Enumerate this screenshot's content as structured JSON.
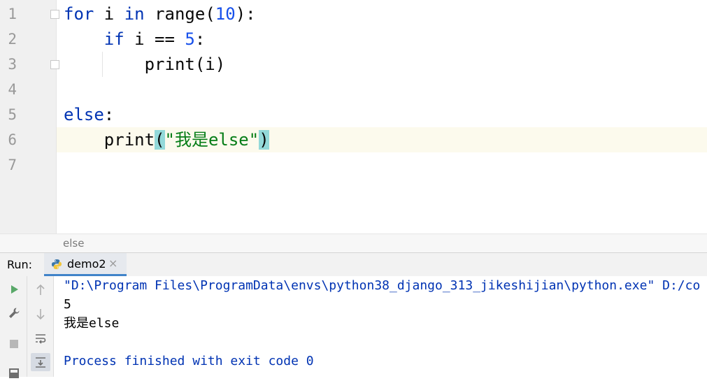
{
  "editor": {
    "line_numbers": [
      "1",
      "2",
      "3",
      "4",
      "5",
      "6",
      "7"
    ],
    "lines": [
      {
        "parts": [
          {
            "t": "for",
            "c": "kw"
          },
          {
            "t": " i "
          },
          {
            "t": "in",
            "c": "kw"
          },
          {
            "t": " range("
          },
          {
            "t": "10",
            "c": "num"
          },
          {
            "t": "):"
          }
        ]
      },
      {
        "parts": [
          {
            "t": "    "
          },
          {
            "t": "if",
            "c": "kw"
          },
          {
            "t": " i == "
          },
          {
            "t": "5",
            "c": "num"
          },
          {
            "t": ":"
          }
        ]
      },
      {
        "parts": [
          {
            "t": "        print(i)"
          }
        ]
      },
      {
        "parts": []
      },
      {
        "parts": [
          {
            "t": "else",
            "c": "kw"
          },
          {
            "t": ":"
          }
        ]
      },
      {
        "parts": [
          {
            "t": "    print"
          },
          {
            "t": "(",
            "c": "paren-hl"
          },
          {
            "t": "\"我是else\"",
            "c": "str"
          },
          {
            "t": ")",
            "c": "paren-hl"
          }
        ]
      },
      {
        "parts": []
      }
    ],
    "current_line": 6
  },
  "breadcrumb": {
    "text": "else"
  },
  "run": {
    "title": "Run:",
    "tab_label": "demo2",
    "tab_close": "×"
  },
  "console": {
    "lines": [
      {
        "text": "\"D:\\Program Files\\ProgramData\\envs\\python38_django_313_jikeshijian\\python.exe\" D:/co",
        "color": "#0033b3"
      },
      {
        "text": "5",
        "color": "#000000"
      },
      {
        "text": "我是else",
        "color": "#000000"
      },
      {
        "text": "",
        "color": "#000000"
      },
      {
        "text": "Process finished with exit code 0",
        "color": "#0033b3"
      }
    ]
  },
  "colors": {
    "keyword": "#0033b3",
    "number": "#1750eb",
    "string": "#067d17",
    "paren_highlight": "#93d9d9",
    "current_line": "#fcfaed",
    "run_green": "#59a869",
    "tab_underline": "#4083c9"
  },
  "icons": [
    "run-icon",
    "wrench-icon",
    "stop-icon",
    "layout-icon",
    "up-arrow-icon",
    "down-arrow-icon",
    "soft-wrap-icon",
    "scroll-to-end-icon",
    "python-icon",
    "fold-marker-icon"
  ]
}
